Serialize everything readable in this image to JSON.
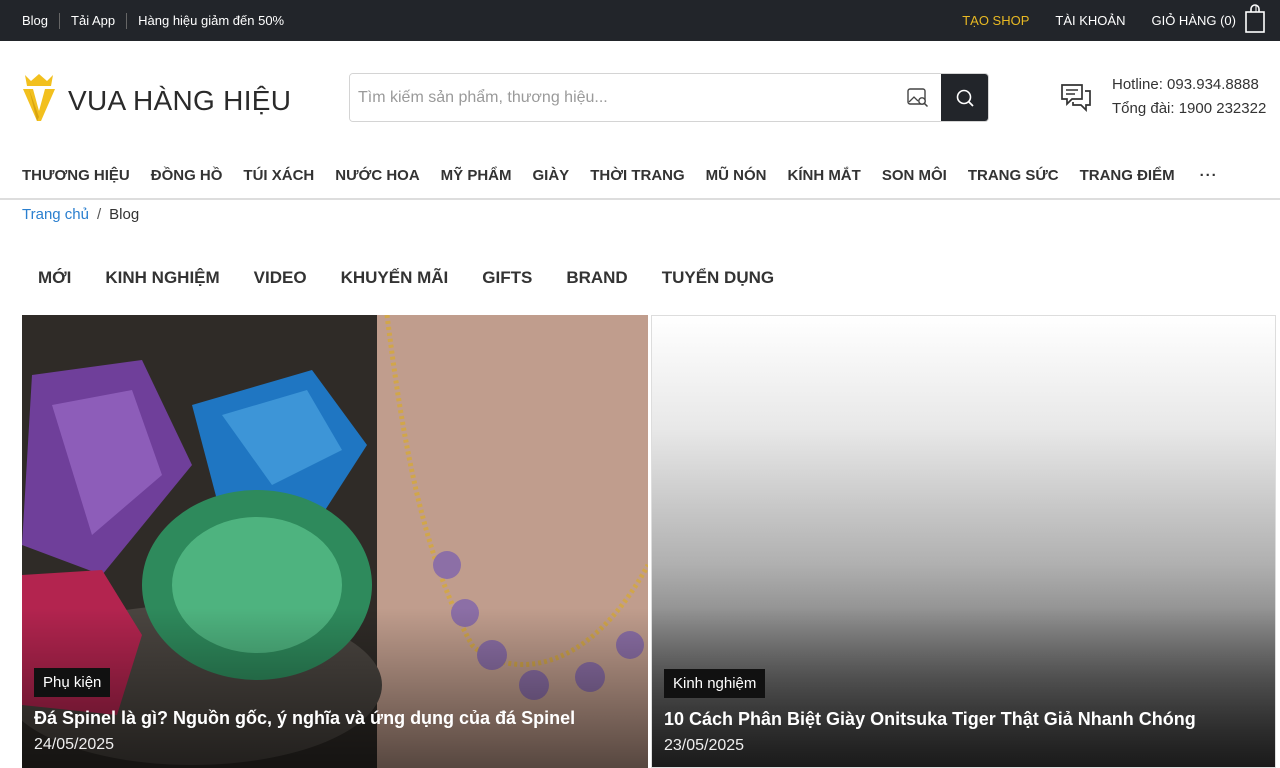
{
  "topbar": {
    "links": [
      "Blog",
      "Tải App",
      "Hàng hiệu giảm đến 50%"
    ],
    "shop": "TẠO SHOP",
    "account": "TÀI KHOẢN",
    "cart": "GIỎ HÀNG (0)"
  },
  "header": {
    "logo_text": "VUA HÀNG HIỆU",
    "search_placeholder": "Tìm kiếm sản phẩm, thương hiệu...",
    "hotline": "Hotline: 093.934.8888",
    "switchboard": "Tổng đài: 1900 232322"
  },
  "nav": [
    "THƯƠNG HIỆU",
    "ĐỒNG HỒ",
    "TÚI XÁCH",
    "NƯỚC HOA",
    "MỸ PHẨM",
    "GIÀY",
    "THỜI TRANG",
    "MŨ NÓN",
    "KÍNH MẮT",
    "SON MÔI",
    "TRANG SỨC",
    "TRANG ĐIỂM"
  ],
  "nav_more": "···",
  "breadcrumb": {
    "home": "Trang chủ",
    "sep": "/",
    "current": "Blog"
  },
  "blog_tabs": [
    "MỚI",
    "KINH NGHIỆM",
    "VIDEO",
    "KHUYẾN MÃI",
    "GIFTS",
    "BRAND",
    "TUYỂN DỤNG"
  ],
  "posts": [
    {
      "tag": "Phụ kiện",
      "title": "Đá Spinel là gì? Nguồn gốc, ý nghĩa và ứng dụng của đá Spinel",
      "date": "24/05/2025"
    },
    {
      "tag": "Kinh nghiệm",
      "title": "10 Cách Phân Biệt Giày Onitsuka Tiger Thật Giả Nhanh Chóng",
      "date": "23/05/2025"
    }
  ],
  "colors": {
    "topbar_bg": "#22252a",
    "accent_gold": "#e8b923",
    "link_blue": "#2a7fcf"
  }
}
